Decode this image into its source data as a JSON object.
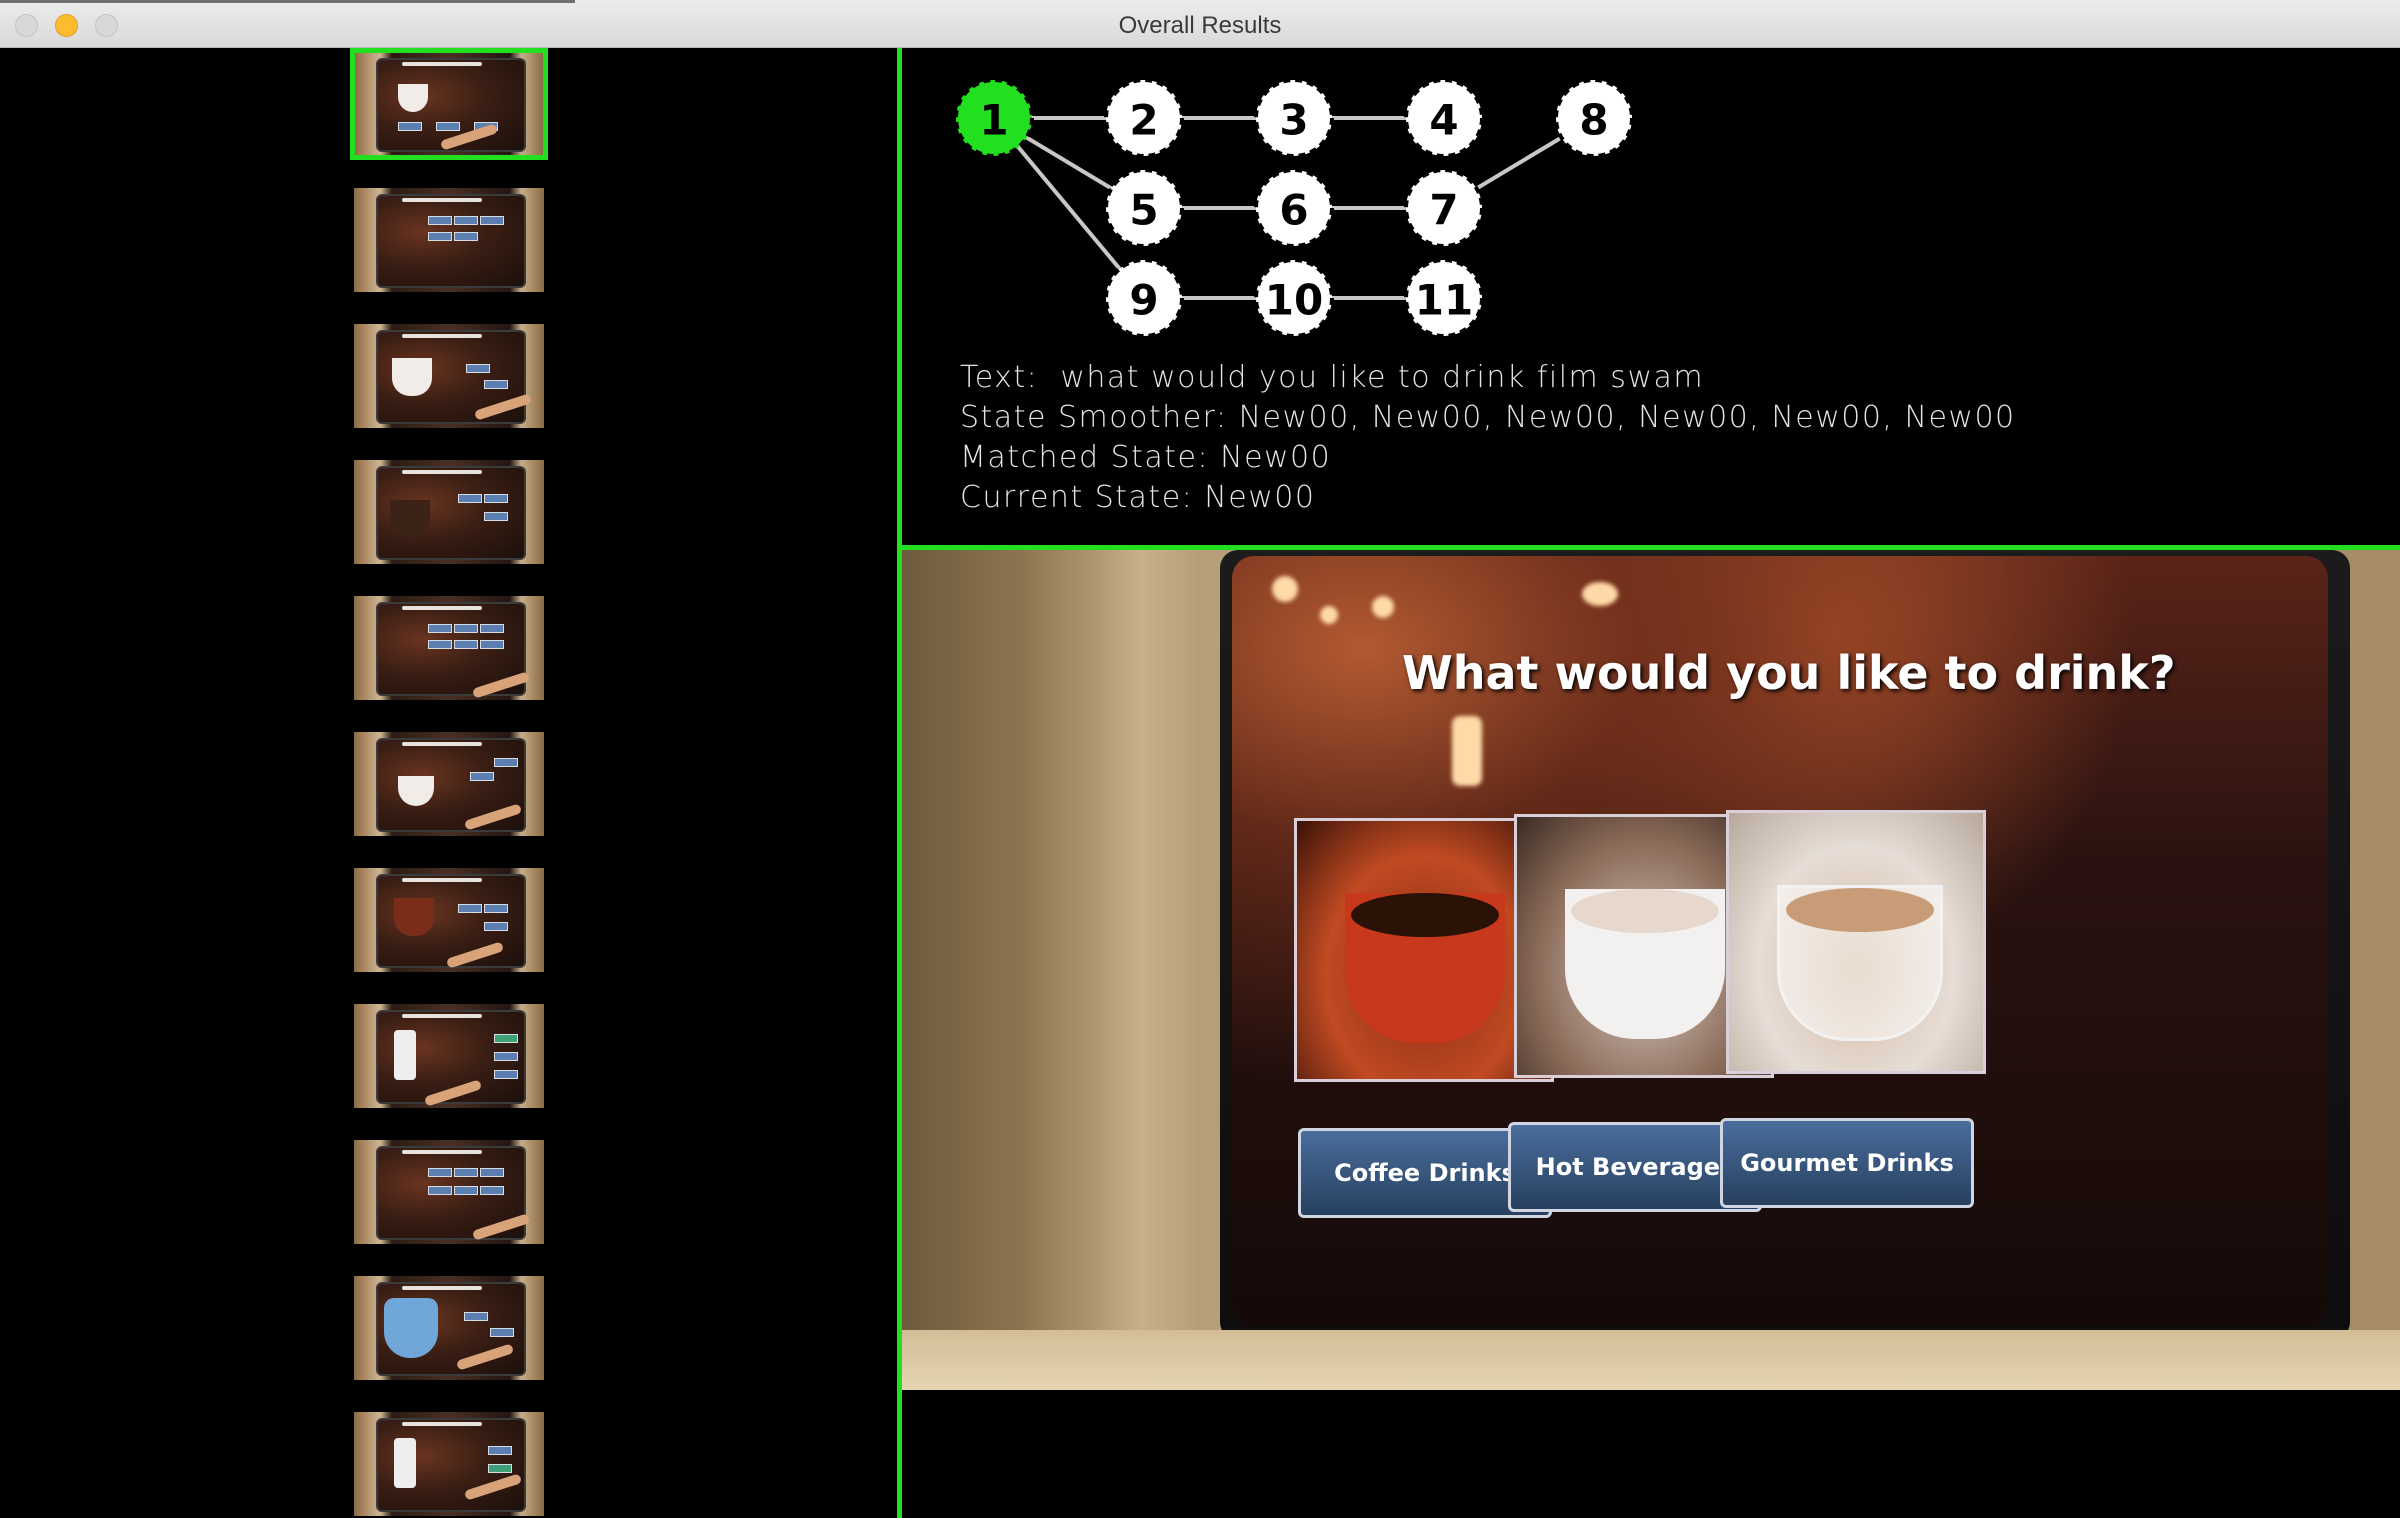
{
  "window": {
    "title": "Overall Results"
  },
  "thumbnails": {
    "count": 11,
    "selected_index": 0
  },
  "state_graph": {
    "active_node": "1",
    "nodes": [
      "1",
      "2",
      "3",
      "4",
      "5",
      "6",
      "7",
      "8",
      "9",
      "10",
      "11"
    ],
    "edges": [
      [
        "1",
        "2"
      ],
      [
        "2",
        "3"
      ],
      [
        "3",
        "4"
      ],
      [
        "1",
        "5"
      ],
      [
        "1",
        "9"
      ],
      [
        "5",
        "6"
      ],
      [
        "6",
        "7"
      ],
      [
        "7",
        "8"
      ],
      [
        "9",
        "10"
      ],
      [
        "10",
        "11"
      ]
    ]
  },
  "info": {
    "text_line": "Text:  what would you like to drink film swam",
    "smoother_line": "State Smoother: New00, New00, New00, New00, New00, New00",
    "matched_line": "Matched State: New00",
    "current_line": "Current State: New00"
  },
  "kiosk": {
    "question": "What would you like to drink?",
    "choices": [
      {
        "label": "Coffee Drinks"
      },
      {
        "label": "Hot Beverages"
      },
      {
        "label": "Gourmet Drinks"
      }
    ]
  },
  "colors": {
    "accent": "#22e01f",
    "background": "#000000"
  }
}
